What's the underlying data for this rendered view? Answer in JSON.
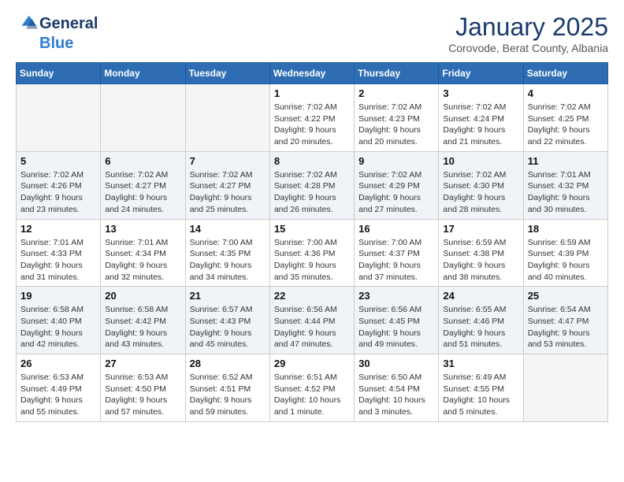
{
  "logo": {
    "general": "General",
    "blue": "Blue"
  },
  "title": "January 2025",
  "subtitle": "Corovode, Berat County, Albania",
  "weekdays": [
    "Sunday",
    "Monday",
    "Tuesday",
    "Wednesday",
    "Thursday",
    "Friday",
    "Saturday"
  ],
  "weeks": [
    [
      {
        "day": "",
        "info": ""
      },
      {
        "day": "",
        "info": ""
      },
      {
        "day": "",
        "info": ""
      },
      {
        "day": "1",
        "info": "Sunrise: 7:02 AM\nSunset: 4:22 PM\nDaylight: 9 hours\nand 20 minutes."
      },
      {
        "day": "2",
        "info": "Sunrise: 7:02 AM\nSunset: 4:23 PM\nDaylight: 9 hours\nand 20 minutes."
      },
      {
        "day": "3",
        "info": "Sunrise: 7:02 AM\nSunset: 4:24 PM\nDaylight: 9 hours\nand 21 minutes."
      },
      {
        "day": "4",
        "info": "Sunrise: 7:02 AM\nSunset: 4:25 PM\nDaylight: 9 hours\nand 22 minutes."
      }
    ],
    [
      {
        "day": "5",
        "info": "Sunrise: 7:02 AM\nSunset: 4:26 PM\nDaylight: 9 hours\nand 23 minutes."
      },
      {
        "day": "6",
        "info": "Sunrise: 7:02 AM\nSunset: 4:27 PM\nDaylight: 9 hours\nand 24 minutes."
      },
      {
        "day": "7",
        "info": "Sunrise: 7:02 AM\nSunset: 4:27 PM\nDaylight: 9 hours\nand 25 minutes."
      },
      {
        "day": "8",
        "info": "Sunrise: 7:02 AM\nSunset: 4:28 PM\nDaylight: 9 hours\nand 26 minutes."
      },
      {
        "day": "9",
        "info": "Sunrise: 7:02 AM\nSunset: 4:29 PM\nDaylight: 9 hours\nand 27 minutes."
      },
      {
        "day": "10",
        "info": "Sunrise: 7:02 AM\nSunset: 4:30 PM\nDaylight: 9 hours\nand 28 minutes."
      },
      {
        "day": "11",
        "info": "Sunrise: 7:01 AM\nSunset: 4:32 PM\nDaylight: 9 hours\nand 30 minutes."
      }
    ],
    [
      {
        "day": "12",
        "info": "Sunrise: 7:01 AM\nSunset: 4:33 PM\nDaylight: 9 hours\nand 31 minutes."
      },
      {
        "day": "13",
        "info": "Sunrise: 7:01 AM\nSunset: 4:34 PM\nDaylight: 9 hours\nand 32 minutes."
      },
      {
        "day": "14",
        "info": "Sunrise: 7:00 AM\nSunset: 4:35 PM\nDaylight: 9 hours\nand 34 minutes."
      },
      {
        "day": "15",
        "info": "Sunrise: 7:00 AM\nSunset: 4:36 PM\nDaylight: 9 hours\nand 35 minutes."
      },
      {
        "day": "16",
        "info": "Sunrise: 7:00 AM\nSunset: 4:37 PM\nDaylight: 9 hours\nand 37 minutes."
      },
      {
        "day": "17",
        "info": "Sunrise: 6:59 AM\nSunset: 4:38 PM\nDaylight: 9 hours\nand 38 minutes."
      },
      {
        "day": "18",
        "info": "Sunrise: 6:59 AM\nSunset: 4:39 PM\nDaylight: 9 hours\nand 40 minutes."
      }
    ],
    [
      {
        "day": "19",
        "info": "Sunrise: 6:58 AM\nSunset: 4:40 PM\nDaylight: 9 hours\nand 42 minutes."
      },
      {
        "day": "20",
        "info": "Sunrise: 6:58 AM\nSunset: 4:42 PM\nDaylight: 9 hours\nand 43 minutes."
      },
      {
        "day": "21",
        "info": "Sunrise: 6:57 AM\nSunset: 4:43 PM\nDaylight: 9 hours\nand 45 minutes."
      },
      {
        "day": "22",
        "info": "Sunrise: 6:56 AM\nSunset: 4:44 PM\nDaylight: 9 hours\nand 47 minutes."
      },
      {
        "day": "23",
        "info": "Sunrise: 6:56 AM\nSunset: 4:45 PM\nDaylight: 9 hours\nand 49 minutes."
      },
      {
        "day": "24",
        "info": "Sunrise: 6:55 AM\nSunset: 4:46 PM\nDaylight: 9 hours\nand 51 minutes."
      },
      {
        "day": "25",
        "info": "Sunrise: 6:54 AM\nSunset: 4:47 PM\nDaylight: 9 hours\nand 53 minutes."
      }
    ],
    [
      {
        "day": "26",
        "info": "Sunrise: 6:53 AM\nSunset: 4:49 PM\nDaylight: 9 hours\nand 55 minutes."
      },
      {
        "day": "27",
        "info": "Sunrise: 6:53 AM\nSunset: 4:50 PM\nDaylight: 9 hours\nand 57 minutes."
      },
      {
        "day": "28",
        "info": "Sunrise: 6:52 AM\nSunset: 4:51 PM\nDaylight: 9 hours\nand 59 minutes."
      },
      {
        "day": "29",
        "info": "Sunrise: 6:51 AM\nSunset: 4:52 PM\nDaylight: 10 hours\nand 1 minute."
      },
      {
        "day": "30",
        "info": "Sunrise: 6:50 AM\nSunset: 4:54 PM\nDaylight: 10 hours\nand 3 minutes."
      },
      {
        "day": "31",
        "info": "Sunrise: 6:49 AM\nSunset: 4:55 PM\nDaylight: 10 hours\nand 5 minutes."
      },
      {
        "day": "",
        "info": ""
      }
    ]
  ],
  "shaded_rows": [
    1,
    3
  ]
}
